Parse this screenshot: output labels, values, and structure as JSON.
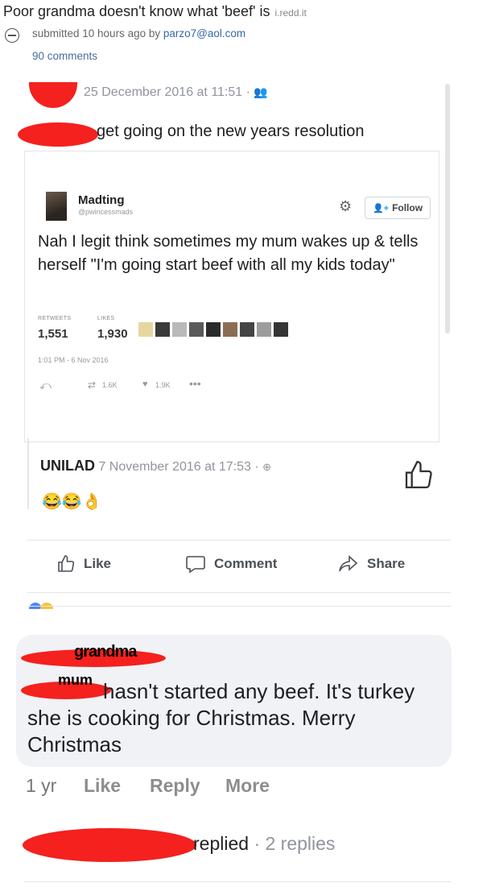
{
  "post": {
    "title": "Poor grandma doesn't know what 'beef' is",
    "domain": "i.redd.it",
    "meta_prefix": "submitted 10 hours ago by",
    "author": "parzo7@aol.com",
    "comments": "90 comments"
  },
  "fb_post": {
    "date": "25 December 2016 at 11:51 ·",
    "text": "get going on the new years resolution"
  },
  "tweet": {
    "name": "Madting",
    "handle": "@pwincessmads",
    "follow_label": "Follow",
    "text": "Nah I legit think sometimes my mum wakes up & tells herself \"I'm going start beef with all my kids today\"",
    "retweets_label": "RETWEETS",
    "retweets": "1,551",
    "likes_label": "LIKES",
    "likes": "1,930",
    "timestamp": "1:01 PM - 6 Nov 2016",
    "rt_count": "1.6K",
    "like_count": "1.9K"
  },
  "share": {
    "page": "UNILAD",
    "date": "7 November 2016 at 17:53 ·",
    "emojis": "😂😂👌"
  },
  "actions": {
    "like": "Like",
    "comment": "Comment",
    "share": "Share"
  },
  "reply": {
    "tag_top": "grandma",
    "tag_mid": "mum",
    "text": "hasn't started any beef. It's turkey she is cooking for Christmas. Merry Christmas",
    "age": "1 yr",
    "like": "Like",
    "reply": "Reply",
    "more": "More"
  },
  "replied": {
    "label": "replied",
    "count": "· 2 replies"
  },
  "colors": {
    "link": "#3369a8",
    "redaction": "#f4211e",
    "twitter_blue": "#1da1f2"
  }
}
